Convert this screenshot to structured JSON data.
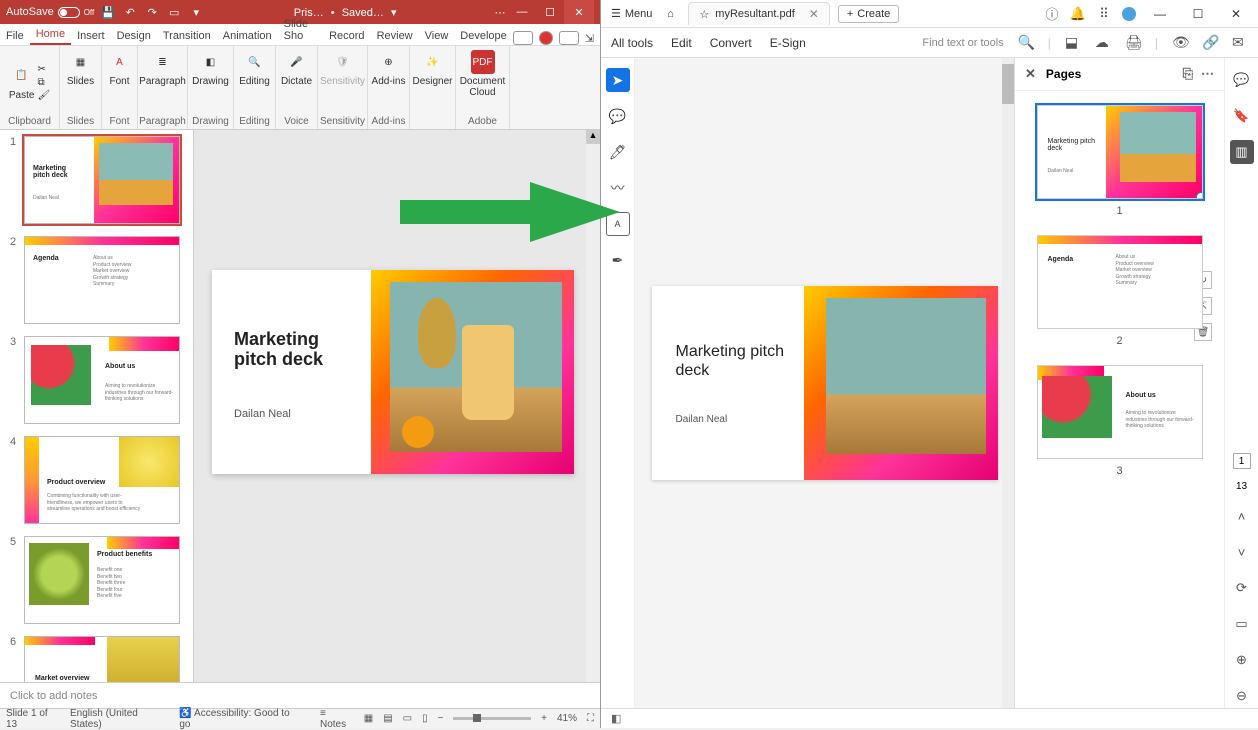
{
  "ppt": {
    "autosave_label": "AutoSave",
    "autosave_state": "Off",
    "doc_name": "Pris…",
    "saved_state": "Saved…",
    "tabs": [
      "File",
      "Home",
      "Insert",
      "Design",
      "Transition",
      "Animation",
      "Slide Sho",
      "Record",
      "Review",
      "View",
      "Develope"
    ],
    "active_tab": "Home",
    "ribbon_groups": {
      "clipboard": {
        "label": "Clipboard",
        "paste": "Paste"
      },
      "slides": {
        "label": "Slides",
        "btn": "Slides"
      },
      "font": {
        "label": "Font",
        "btn": "Font"
      },
      "paragraph": {
        "label": "Paragraph",
        "btn": "Paragraph"
      },
      "drawing": {
        "label": "Drawing",
        "btn": "Drawing"
      },
      "editing": {
        "label": "Editing",
        "btn": "Editing"
      },
      "voice": {
        "label": "Voice",
        "btn": "Dictate"
      },
      "sensitivity": {
        "label": "Sensitivity",
        "btn": "Sensitivity"
      },
      "addins": {
        "label": "Add-ins",
        "btn": "Add-ins"
      },
      "designer": {
        "label": "",
        "btn": "Designer"
      },
      "adobe": {
        "label": "Adobe",
        "btn": "Document Cloud"
      }
    },
    "slides": [
      {
        "n": "1",
        "title": "Marketing pitch deck",
        "sub": "Dailan Neal"
      },
      {
        "n": "2",
        "title": "Agenda",
        "items": [
          "About us",
          "Product overview",
          "Market overview",
          "Growth strategy",
          "Summary"
        ]
      },
      {
        "n": "3",
        "title": "About us",
        "sub": "Aiming to revolutionize industries through our forward-thinking solutions"
      },
      {
        "n": "4",
        "title": "Product overview",
        "sub": "Combining functionality with user-friendliness, we empower users to streamline operations and boost efficiency"
      },
      {
        "n": "5",
        "title": "Product benefits",
        "items": [
          "Benefit one",
          "Benefit two",
          "Benefit three",
          "Benefit four",
          "Benefit five"
        ]
      },
      {
        "n": "6",
        "title": "Market overview"
      }
    ],
    "main_slide": {
      "title_l1": "Marketing",
      "title_l2": "pitch deck",
      "author": "Dailan Neal"
    },
    "notes_placeholder": "Click to add notes",
    "status": {
      "slide_pos": "Slide 1 of 13",
      "lang": "English (United States)",
      "accessibility": "Accessibility: Good to go",
      "notes_btn": "Notes",
      "zoom": "41%"
    }
  },
  "acrobat": {
    "menu": "Menu",
    "tab_name": "myResultant.pdf",
    "create": "Create",
    "toolbar": {
      "all_tools": "All tools",
      "edit": "Edit",
      "convert": "Convert",
      "esign": "E-Sign",
      "find": "Find text or tools"
    },
    "pages_panel": {
      "title": "Pages"
    },
    "page": {
      "title_l1": "Marketing pitch",
      "title_l2": "deck",
      "author": "Dailan Neal"
    },
    "thumbs": [
      {
        "n": "1",
        "title": "Marketing pitch deck",
        "sub": "Dailan Neal"
      },
      {
        "n": "2",
        "title": "Agenda",
        "items": [
          "About us",
          "Product overview",
          "Market overview",
          "Growth strategy",
          "Summary"
        ]
      },
      {
        "n": "3",
        "title": "About us",
        "sub": "Aiming to revolutionize industries through our forward-thinking solutions"
      }
    ],
    "right_rail_page": "1",
    "right_rail_total": "13"
  }
}
